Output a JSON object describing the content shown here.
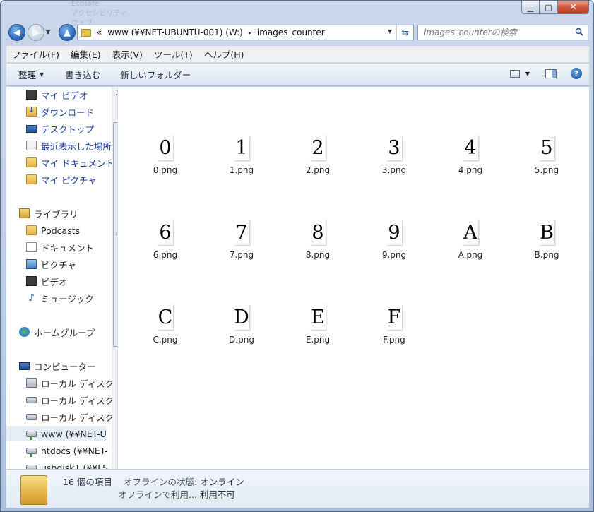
{
  "titlebar": {
    "ghost_lines": [
      "Ecosafe",
      "アクセシビリティ",
      "ウェブ"
    ]
  },
  "window_controls": {
    "min": "▁",
    "max": "□",
    "close": "✕"
  },
  "address": {
    "prefix": "«",
    "location": "www (¥¥NET-UBUNTU-001) (W:)",
    "separator": "▸",
    "folder": "images_counter"
  },
  "search": {
    "placeholder": "images_counterの検索"
  },
  "menu": [
    "ファイル(F)",
    "編集(E)",
    "表示(V)",
    "ツール(T)",
    "ヘルプ(H)"
  ],
  "commands": {
    "organize": "整理",
    "burn": "書き込む",
    "new_folder": "新しいフォルダー"
  },
  "nav": {
    "favorites": [
      {
        "label": "マイ ビデオ",
        "icon": "video-folder-icon"
      },
      {
        "label": "ダウンロード",
        "icon": "downloads-icon"
      },
      {
        "label": "デスクトップ",
        "icon": "desktop-icon"
      },
      {
        "label": "最近表示した場所",
        "icon": "recent-places-icon"
      },
      {
        "label": "マイ ドキュメント",
        "icon": "documents-folder-icon"
      },
      {
        "label": "マイ ピクチャ",
        "icon": "pictures-folder-icon"
      }
    ],
    "library": {
      "label": "ライブラリ",
      "items": [
        {
          "label": "Podcasts",
          "icon": "folder-icon"
        },
        {
          "label": "ドキュメント",
          "icon": "document-icon"
        },
        {
          "label": "ピクチャ",
          "icon": "picture-icon"
        },
        {
          "label": "ビデオ",
          "icon": "video-icon"
        },
        {
          "label": "ミュージック",
          "icon": "music-icon"
        }
      ]
    },
    "homegroup": "ホームグループ",
    "computer": {
      "label": "コンピューター",
      "items": [
        {
          "label": "ローカル ディスク",
          "icon": "windows-disk-icon"
        },
        {
          "label": "ローカル ディスク",
          "icon": "disk-icon"
        },
        {
          "label": "ローカル ディスク",
          "icon": "disk-icon"
        },
        {
          "label": "www (¥¥NET-U",
          "icon": "network-drive-icon"
        },
        {
          "label": "htdocs (¥¥NET-",
          "icon": "network-drive-icon"
        },
        {
          "label": "usbdisk1 (¥¥LS",
          "icon": "network-drive-icon"
        }
      ]
    }
  },
  "files": [
    {
      "glyph": "0",
      "name": "0.png"
    },
    {
      "glyph": "1",
      "name": "1.png"
    },
    {
      "glyph": "2",
      "name": "2.png"
    },
    {
      "glyph": "3",
      "name": "3.png"
    },
    {
      "glyph": "4",
      "name": "4.png"
    },
    {
      "glyph": "5",
      "name": "5.png"
    },
    {
      "glyph": "6",
      "name": "6.png"
    },
    {
      "glyph": "7",
      "name": "7.png"
    },
    {
      "glyph": "8",
      "name": "8.png"
    },
    {
      "glyph": "9",
      "name": "9.png"
    },
    {
      "glyph": "A",
      "name": "A.png"
    },
    {
      "glyph": "B",
      "name": "B.png"
    },
    {
      "glyph": "C",
      "name": "C.png"
    },
    {
      "glyph": "D",
      "name": "D.png"
    },
    {
      "glyph": "E",
      "name": "E.png"
    },
    {
      "glyph": "F",
      "name": "F.png"
    }
  ],
  "status": {
    "count": "16 個の項目",
    "offline_label": "オフラインの状態:",
    "offline_value": "オンライン",
    "usage_label": "オフラインで利用...",
    "usage_value": "利用不可"
  },
  "colors": {
    "link": "#1a3fa3",
    "selection": "#e4ecf6",
    "accent": "#2e6dbb"
  }
}
